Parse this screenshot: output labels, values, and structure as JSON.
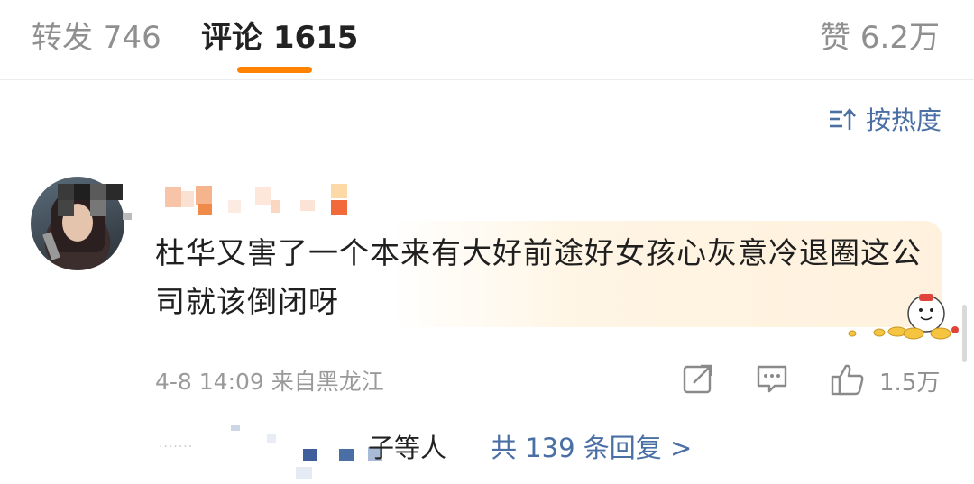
{
  "tabs": {
    "repost": "转发 746",
    "comment": "评论 1615",
    "like": "赞 6.2万"
  },
  "sort": {
    "label": "按热度"
  },
  "comment": {
    "text": "杜华又害了一个本来有大好前途好女孩心灰意冷退圈这公司就该倒闭呀",
    "meta": "4-8 14:09 来自黑龙江",
    "like_count": "1.5万"
  },
  "replies": {
    "names_suffix": "子等人",
    "total_label": "共 139 条回复 >"
  },
  "colors": {
    "accent": "#ff8200",
    "link": "#4a6fa5",
    "muted": "#9a9a9a"
  }
}
